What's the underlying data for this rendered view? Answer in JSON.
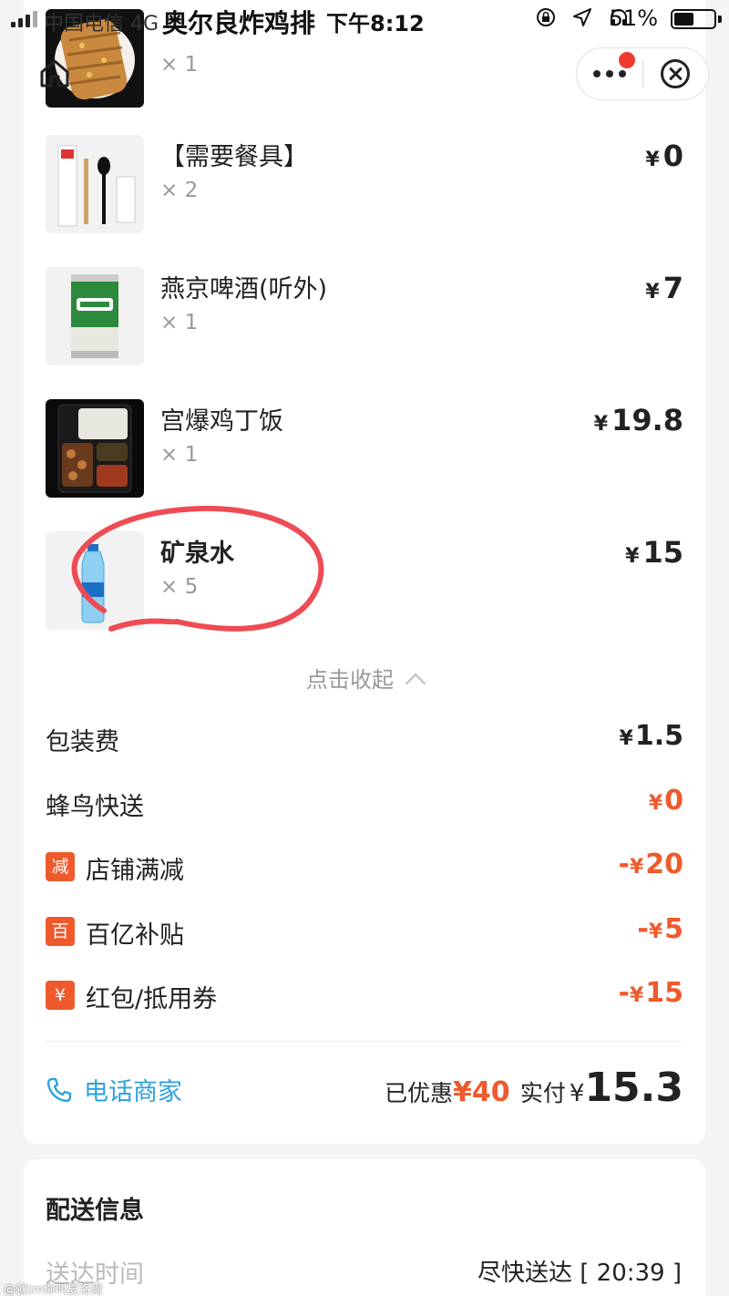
{
  "status_bar": {
    "carrier": "中国电信 4G",
    "shop_title": "奥尔良炸鸡排",
    "time": "下午8:12",
    "battery_percent": "51%",
    "battery_level": 0.51
  },
  "capsule": {
    "more_icon": "more-dots-icon",
    "close_icon": "close-circle-icon",
    "badge_color": "#f03c2f"
  },
  "order_items": [
    {
      "name": "",
      "qty": "× 1",
      "price": "",
      "thumb": "fried-chicken"
    },
    {
      "name": "【需要餐具】",
      "qty": "× 2",
      "price": "0",
      "thumb": "cutlery"
    },
    {
      "name": "燕京啤酒(听外)",
      "qty": "× 1",
      "price": "7",
      "thumb": "beer-can"
    },
    {
      "name": "宫爆鸡丁饭",
      "qty": "× 1",
      "price": "19.8",
      "thumb": "rice-box"
    },
    {
      "name": "矿泉水",
      "qty": "× 5",
      "price": "15",
      "thumb": "water-bottle"
    }
  ],
  "currency": "¥",
  "collapse_label": "点击收起",
  "fees": [
    {
      "label": "包装费",
      "value": "1.5",
      "badge": "",
      "highlight": false
    },
    {
      "label": "蜂鸟快送",
      "value": "0",
      "badge": "",
      "highlight": true
    },
    {
      "label": "店铺满减",
      "value": "20",
      "badge": "减",
      "highlight": true,
      "prefix": "-"
    },
    {
      "label": "百亿补贴",
      "value": "5",
      "badge": "百",
      "highlight": true,
      "prefix": "-"
    },
    {
      "label": "红包/抵用券",
      "value": "15",
      "badge": "¥",
      "highlight": true,
      "prefix": "-"
    }
  ],
  "footer": {
    "call_label": "电话商家",
    "saved_label": "已优惠",
    "saved_amount": "¥40",
    "paid_label": "实付",
    "paid_amount": "15.3"
  },
  "delivery": {
    "title": "配送信息",
    "time_label": "送达时间",
    "time_value": "尽快送达 [ 20:39 ]"
  },
  "watermark": "@就tm你叫夏洛爾",
  "colors": {
    "accent_orange": "#ee5a2c",
    "link_blue": "#2ea2e0",
    "annotation_red": "#ef4b54"
  }
}
